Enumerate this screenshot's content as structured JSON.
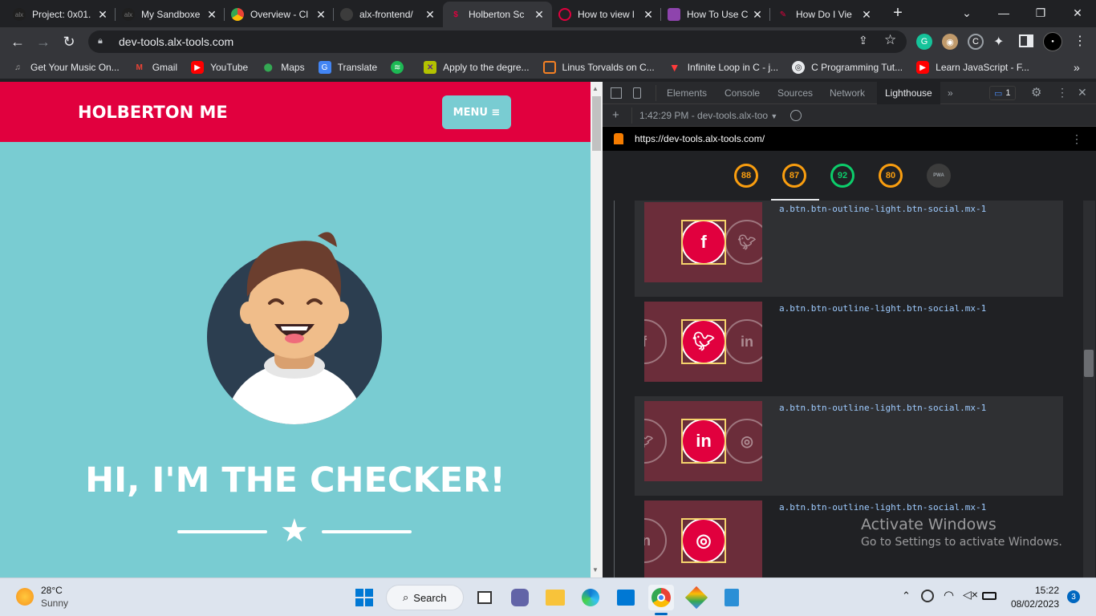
{
  "browser": {
    "tabs": [
      {
        "title": "Project: 0x01.",
        "icon": "alx-favicon"
      },
      {
        "title": "My Sandboxe",
        "icon": "alx-favicon"
      },
      {
        "title": "Overview - Cl",
        "icon": "chrome-favicon"
      },
      {
        "title": "alx-frontend/",
        "icon": "github-favicon"
      },
      {
        "title": "Holberton Sc",
        "icon": "holberton-favicon"
      },
      {
        "title": "How to view l",
        "icon": "site-favicon"
      },
      {
        "title": "How To Use C",
        "icon": "site-favicon"
      },
      {
        "title": "How Do I Vie",
        "icon": "site-favicon"
      }
    ],
    "active_tab": 4,
    "url": "dev-tools.alx-tools.com",
    "bookmarks": [
      {
        "label": "Get Your Music On...",
        "icon": "music-icon"
      },
      {
        "label": "Gmail",
        "icon": "gmail-icon"
      },
      {
        "label": "YouTube",
        "icon": "youtube-icon"
      },
      {
        "label": "Maps",
        "icon": "maps-icon"
      },
      {
        "label": "Translate",
        "icon": "translate-icon"
      },
      {
        "label": "",
        "icon": "spotify-icon"
      },
      {
        "label": "Apply to the degre...",
        "icon": "apply-icon"
      },
      {
        "label": "Linus Torvalds on C...",
        "icon": "linus-icon"
      },
      {
        "label": "Infinite Loop in C - j...",
        "icon": "infinite-icon"
      },
      {
        "label": "C Programming Tut...",
        "icon": "c-icon"
      },
      {
        "label": "Learn JavaScript - F...",
        "icon": "youtube-icon"
      }
    ]
  },
  "page": {
    "brand": "HOLBERTON ME",
    "menu_label": "MENU ≡",
    "hero_title": "HI, I'M THE CHECKER!"
  },
  "devtools": {
    "tabs": [
      "Elements",
      "Console",
      "Sources",
      "Network",
      "Lighthouse"
    ],
    "active_tab": "Lighthouse",
    "issues_count": "1",
    "report_time": "1:42:29 PM - dev-tools.alx-too",
    "report_url": "https://dev-tools.alx-tools.com/",
    "scores": [
      {
        "value": "88",
        "color": "#fa9e0f"
      },
      {
        "value": "87",
        "color": "#fa9e0f"
      },
      {
        "value": "92",
        "color": "#0cce6b"
      },
      {
        "value": "80",
        "color": "#fa9e0f"
      },
      {
        "value": "PWA",
        "color": "#9aa0a6"
      }
    ],
    "rows": [
      {
        "selector": "a.btn.btn-outline-light.btn-social.mx-1",
        "main": "f",
        "left": "",
        "right": "t"
      },
      {
        "selector": "a.btn.btn-outline-light.btn-social.mx-1",
        "main": "t",
        "left": "f",
        "right": "in"
      },
      {
        "selector": "a.btn.btn-outline-light.btn-social.mx-1",
        "main": "in",
        "left": "t",
        "right": "d"
      },
      {
        "selector": "a.btn.btn-outline-light.btn-social.mx-1",
        "main": "d",
        "left": "in",
        "right": ""
      }
    ]
  },
  "watermark": {
    "line1": "Activate Windows",
    "line2": "Go to Settings to activate Windows."
  },
  "taskbar": {
    "temperature": "28°C",
    "weather": "Sunny",
    "search_label": "Search",
    "time": "15:22",
    "date": "08/02/2023",
    "notification_count": "3"
  }
}
